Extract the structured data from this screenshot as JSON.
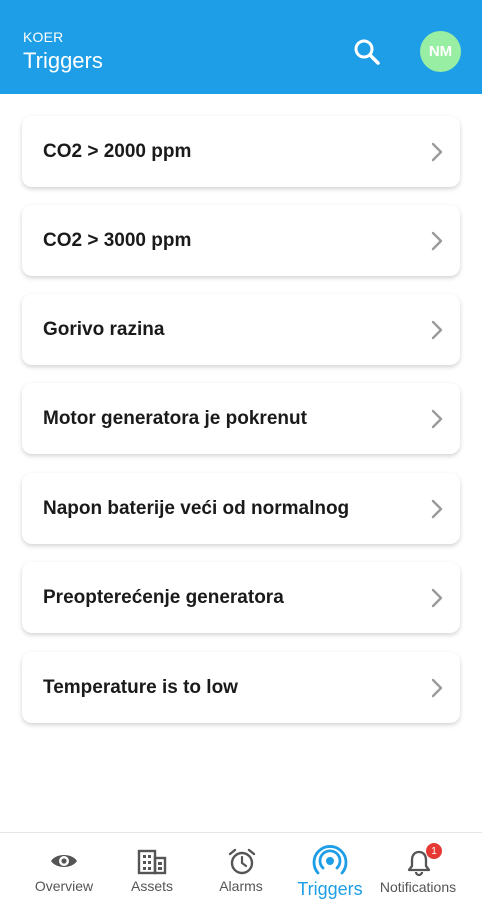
{
  "header": {
    "subtitle": "KOER",
    "title": "Triggers",
    "avatar_initials": "NM",
    "icons": {
      "search": "search-icon"
    },
    "colors": {
      "bar": "#1e9ee6",
      "avatar": "#98eea2"
    }
  },
  "triggers": [
    {
      "label": "CO2 > 2000 ppm"
    },
    {
      "label": "CO2 > 3000 ppm"
    },
    {
      "label": "Gorivo razina"
    },
    {
      "label": "Motor generatora je pokrenut"
    },
    {
      "label": "Napon baterije veći od normalnog"
    },
    {
      "label": "Preopterećenje generatora"
    },
    {
      "label": "Temperature is to low"
    }
  ],
  "nav": {
    "items": [
      {
        "label": "Overview",
        "icon": "eye-icon",
        "active": false
      },
      {
        "label": "Assets",
        "icon": "building-icon",
        "active": false
      },
      {
        "label": "Alarms",
        "icon": "alarm-clock-icon",
        "active": false
      },
      {
        "label": "Triggers",
        "icon": "broadcast-icon",
        "active": true
      },
      {
        "label": "Notifications",
        "icon": "bell-icon",
        "active": false,
        "badge": "1"
      }
    ],
    "colors": {
      "active": "#1e9ee6",
      "inactive": "#555555",
      "badge": "#e53935"
    }
  }
}
